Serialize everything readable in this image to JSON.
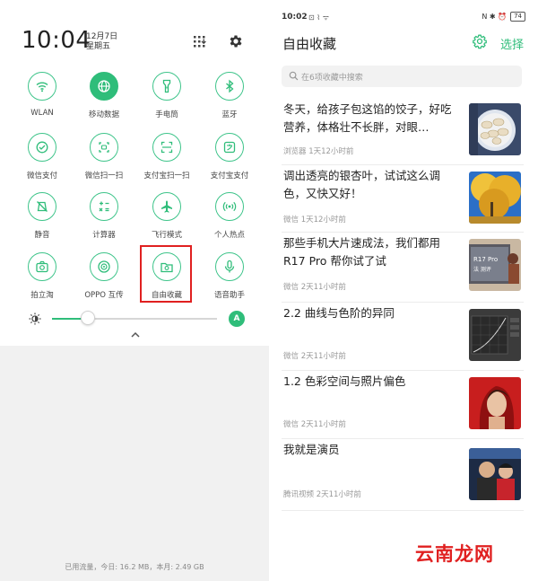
{
  "left": {
    "time": "10:04",
    "date": "12月7日",
    "weekday": "星期五",
    "tiles": [
      {
        "label": "WLAN",
        "icon": "wifi-icon"
      },
      {
        "label": "移动数据",
        "icon": "globe-icon",
        "active": true
      },
      {
        "label": "手电筒",
        "icon": "flashlight-icon"
      },
      {
        "label": "蓝牙",
        "icon": "bluetooth-icon"
      },
      {
        "label": "微信支付",
        "icon": "wechat-pay-icon"
      },
      {
        "label": "微信扫一扫",
        "icon": "wechat-scan-icon"
      },
      {
        "label": "支付宝扫一扫",
        "icon": "alipay-scan-icon"
      },
      {
        "label": "支付宝支付",
        "icon": "alipay-pay-icon"
      },
      {
        "label": "静音",
        "icon": "mute-icon"
      },
      {
        "label": "计算器",
        "icon": "calculator-icon"
      },
      {
        "label": "飞行模式",
        "icon": "airplane-icon"
      },
      {
        "label": "个人热点",
        "icon": "hotspot-icon"
      },
      {
        "label": "拍立淘",
        "icon": "camera-icon"
      },
      {
        "label": "OPPO 互传",
        "icon": "share-icon"
      },
      {
        "label": "自由收藏",
        "icon": "favorites-folder-icon"
      },
      {
        "label": "语音助手",
        "icon": "microphone-icon"
      }
    ],
    "brightness_level": 0.22,
    "auto_label": "A",
    "data_usage": "已用流量，今日: 16.2 MB，本月: 2.49 GB"
  },
  "right": {
    "status_time": "10:02",
    "status_icons": "⊡ ⌇ ᯤ",
    "status_misc": "N ✱ ⏰",
    "battery": "74",
    "title": "自由收藏",
    "select_label": "选择",
    "search_placeholder": "在6项收藏中搜索",
    "items": [
      {
        "title": "冬天，给孩子包这馅的饺子，好吃营养，体格壮不长胖，对眼…",
        "meta": "浏览器  1天12小时前"
      },
      {
        "title": "调出透亮的银杏叶，试试这么调色，又快又好！",
        "meta": "微信  1天12小时前"
      },
      {
        "title": "那些手机大片速成法，我们都用 R17 Pro 帮你试了试",
        "meta": "微信  2天11小时前",
        "thumb_text": "R17 Pro\n法 测评"
      },
      {
        "title": "2.2 曲线与色阶的异同",
        "meta": "微信  2天11小时前"
      },
      {
        "title": "1.2  色彩空间与照片偏色",
        "meta": "微信  2天11小时前"
      },
      {
        "title": "我就是演员",
        "meta": "腾讯视频  2天11小时前"
      }
    ]
  },
  "watermark": "云南龙网",
  "colors": {
    "accent": "#2fbd7a",
    "highlight": "#e02020"
  }
}
